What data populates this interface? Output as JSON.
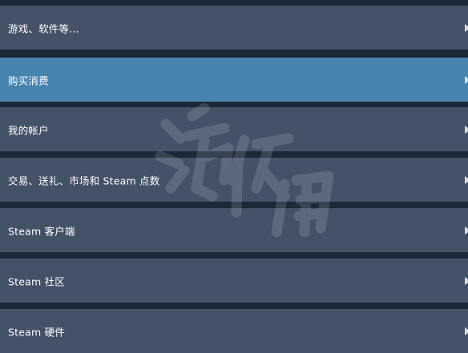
{
  "menu": {
    "items": [
      {
        "label": "游戏、软件等..."
      },
      {
        "label": "购买消费"
      },
      {
        "label": "我的帐户"
      },
      {
        "label": "交易、送礼、市场和 Steam 点数"
      },
      {
        "label": "Steam 客户端"
      },
      {
        "label": "Steam 社区"
      },
      {
        "label": "Steam 硬件"
      }
    ],
    "selected_index": 1
  },
  "watermark": "游侠网",
  "colors": {
    "page_background": "#1b2838",
    "item_background": "#445268",
    "item_selected_background": "#4684ae",
    "text": "#ffffff",
    "arrow": "#d6dbe2"
  },
  "icons": {
    "item_arrow": "chevron-right-icon"
  }
}
